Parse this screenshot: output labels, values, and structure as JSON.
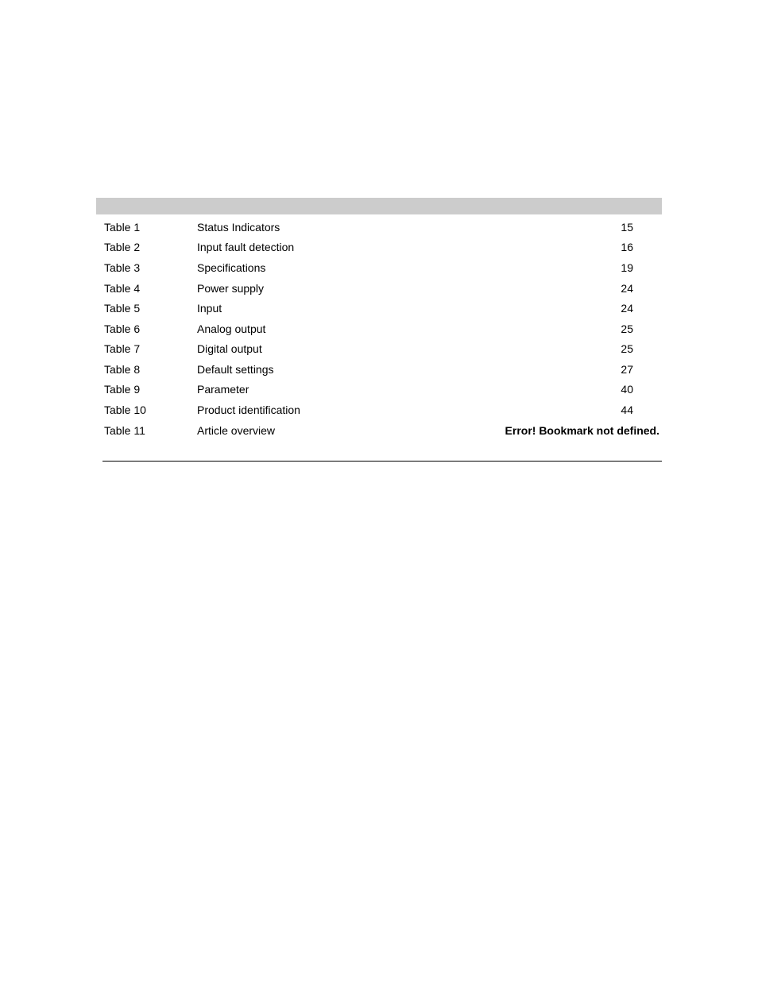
{
  "list_of_tables": {
    "entries": [
      {
        "number": "Table 1",
        "title": "Status Indicators",
        "page": "15"
      },
      {
        "number": "Table 2",
        "title": "Input fault detection",
        "page": "16"
      },
      {
        "number": "Table 3",
        "title": "Specifications",
        "page": "19"
      },
      {
        "number": "Table 4",
        "title": "Power supply",
        "page": "24"
      },
      {
        "number": "Table 5",
        "title": "Input",
        "page": "24"
      },
      {
        "number": "Table 6",
        "title": "Analog output",
        "page": "25"
      },
      {
        "number": "Table 7",
        "title": "Digital output",
        "page": "25"
      },
      {
        "number": "Table 8",
        "title": "Default settings",
        "page": "27"
      },
      {
        "number": "Table 9",
        "title": "Parameter",
        "page": "40"
      },
      {
        "number": "Table 10",
        "title": "Product identification",
        "page": "44"
      },
      {
        "number": "Table 11",
        "title": "Article overview",
        "page": "Error! Bookmark not defined."
      }
    ]
  }
}
